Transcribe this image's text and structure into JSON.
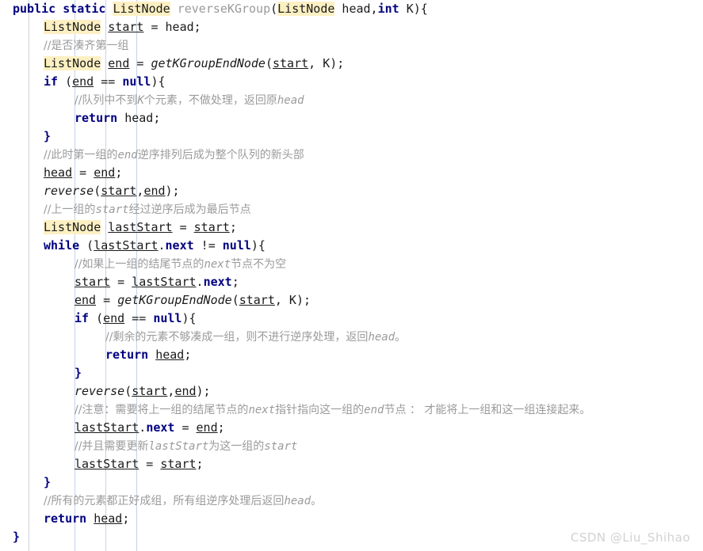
{
  "editor": {
    "language": "java",
    "colors": {
      "keyword": "#000080",
      "highlight_background": "#fcf0c3",
      "comment": "#9b9b9b",
      "method_name": "#9a9a9a",
      "text": "#1a1a1a",
      "indent_guide": "#c3d4e8",
      "background": "#ffffff",
      "watermark": "#d2d2d2"
    },
    "watermark": "CSDN @Liu_Shihao",
    "lines": [
      {
        "indent": 0,
        "tokens": [
          {
            "t": "public",
            "s": "kw"
          },
          {
            "t": " ",
            "s": "plain"
          },
          {
            "t": "static",
            "s": "kw"
          },
          {
            "t": " ",
            "s": "plain"
          },
          {
            "t": "ListNode",
            "s": "type-hl"
          },
          {
            "t": " ",
            "s": "plain"
          },
          {
            "t": "reverseKGroup",
            "s": "mname"
          },
          {
            "t": "(",
            "s": "plain"
          },
          {
            "t": "ListNode",
            "s": "type-hl"
          },
          {
            "t": " head,",
            "s": "plain"
          },
          {
            "t": "int",
            "s": "kw"
          },
          {
            "t": " K){",
            "s": "plain"
          }
        ]
      },
      {
        "indent": 1,
        "tokens": [
          {
            "t": "ListNode",
            "s": "type-hl"
          },
          {
            "t": " ",
            "s": "plain"
          },
          {
            "t": "start",
            "s": "var-u"
          },
          {
            "t": " = head;",
            "s": "plain"
          }
        ]
      },
      {
        "indent": 1,
        "comment": "//是否凑齐第一组"
      },
      {
        "indent": 1,
        "tokens": [
          {
            "t": "ListNode",
            "s": "type-hl"
          },
          {
            "t": " ",
            "s": "plain"
          },
          {
            "t": "end",
            "s": "var-u"
          },
          {
            "t": " = ",
            "s": "plain"
          },
          {
            "t": "getKGroupEndNode",
            "s": "fn-italic"
          },
          {
            "t": "(",
            "s": "plain"
          },
          {
            "t": "start",
            "s": "var-u"
          },
          {
            "t": ", K);",
            "s": "plain"
          }
        ]
      },
      {
        "indent": 1,
        "tokens": [
          {
            "t": "if",
            "s": "kw"
          },
          {
            "t": " (",
            "s": "plain"
          },
          {
            "t": "end",
            "s": "var-u"
          },
          {
            "t": " == ",
            "s": "plain"
          },
          {
            "t": "null",
            "s": "kw"
          },
          {
            "t": "){",
            "s": "plain"
          }
        ]
      },
      {
        "indent": 2,
        "comment": "//队列中不到<i>K</i>个元素，不做处理，返回原<i>head</i>"
      },
      {
        "indent": 2,
        "tokens": [
          {
            "t": "return",
            "s": "kw"
          },
          {
            "t": " head;",
            "s": "plain"
          }
        ]
      },
      {
        "indent": 1,
        "tokens": [
          {
            "t": "}",
            "s": "kw"
          }
        ]
      },
      {
        "indent": 1,
        "comment": "//此时第一组的<i>end</i>逆序排列后成为整个队列的新头部"
      },
      {
        "indent": 1,
        "tokens": [
          {
            "t": "head",
            "s": "var-u"
          },
          {
            "t": " = ",
            "s": "plain"
          },
          {
            "t": "end",
            "s": "var-u"
          },
          {
            "t": ";",
            "s": "plain"
          }
        ]
      },
      {
        "indent": 1,
        "tokens": [
          {
            "t": "reverse",
            "s": "fn-italic"
          },
          {
            "t": "(",
            "s": "plain"
          },
          {
            "t": "start",
            "s": "var-u"
          },
          {
            "t": ",",
            "s": "plain"
          },
          {
            "t": "end",
            "s": "var-u"
          },
          {
            "t": ");",
            "s": "plain"
          }
        ]
      },
      {
        "indent": 1,
        "comment": "//上一组的<i>start</i>经过逆序后成为最后节点"
      },
      {
        "indent": 1,
        "tokens": [
          {
            "t": "ListNode",
            "s": "type-hl"
          },
          {
            "t": " ",
            "s": "plain"
          },
          {
            "t": "lastStart",
            "s": "var-u"
          },
          {
            "t": " = ",
            "s": "plain"
          },
          {
            "t": "start",
            "s": "var-u"
          },
          {
            "t": ";",
            "s": "plain"
          }
        ]
      },
      {
        "indent": 1,
        "tokens": [
          {
            "t": "while",
            "s": "kw"
          },
          {
            "t": " (",
            "s": "plain"
          },
          {
            "t": "lastStart",
            "s": "var-u"
          },
          {
            "t": ".",
            "s": "plain"
          },
          {
            "t": "next",
            "s": "field"
          },
          {
            "t": " != ",
            "s": "plain"
          },
          {
            "t": "null",
            "s": "kw"
          },
          {
            "t": "){",
            "s": "plain"
          }
        ]
      },
      {
        "indent": 2,
        "comment": "//如果上一组的结尾节点的<i>next</i>节点不为空"
      },
      {
        "indent": 2,
        "tokens": [
          {
            "t": "start",
            "s": "var-u"
          },
          {
            "t": " = ",
            "s": "plain"
          },
          {
            "t": "lastStart",
            "s": "var-u"
          },
          {
            "t": ".",
            "s": "plain"
          },
          {
            "t": "next",
            "s": "field"
          },
          {
            "t": ";",
            "s": "plain"
          }
        ]
      },
      {
        "indent": 2,
        "tokens": [
          {
            "t": "end",
            "s": "var-u"
          },
          {
            "t": " = ",
            "s": "plain"
          },
          {
            "t": "getKGroupEndNode",
            "s": "fn-italic"
          },
          {
            "t": "(",
            "s": "plain"
          },
          {
            "t": "start",
            "s": "var-u"
          },
          {
            "t": ", K);",
            "s": "plain"
          }
        ]
      },
      {
        "indent": 2,
        "tokens": [
          {
            "t": "if",
            "s": "kw"
          },
          {
            "t": " (",
            "s": "plain"
          },
          {
            "t": "end",
            "s": "var-u"
          },
          {
            "t": " == ",
            "s": "plain"
          },
          {
            "t": "null",
            "s": "kw"
          },
          {
            "t": "){",
            "s": "plain"
          }
        ]
      },
      {
        "indent": 3,
        "comment": "//剩余的元素不够凑成一组，则不进行逆序处理，返回<i>head</i>。"
      },
      {
        "indent": 3,
        "tokens": [
          {
            "t": "return",
            "s": "kw"
          },
          {
            "t": " ",
            "s": "plain"
          },
          {
            "t": "head",
            "s": "var-u"
          },
          {
            "t": ";",
            "s": "plain"
          }
        ]
      },
      {
        "indent": 2,
        "tokens": [
          {
            "t": "}",
            "s": "kw"
          }
        ]
      },
      {
        "indent": 2,
        "tokens": [
          {
            "t": "reverse",
            "s": "fn-italic"
          },
          {
            "t": "(",
            "s": "plain"
          },
          {
            "t": "start",
            "s": "var-u"
          },
          {
            "t": ",",
            "s": "plain"
          },
          {
            "t": "end",
            "s": "var-u"
          },
          {
            "t": ");",
            "s": "plain"
          }
        ]
      },
      {
        "indent": 2,
        "comment": "//注意：需要将上一组的结尾节点的<i>next</i>指针指向这一组的<i>end</i>节点 ： 才能将上一组和这一组连接起来。"
      },
      {
        "indent": 2,
        "tokens": [
          {
            "t": "lastStart",
            "s": "var-u"
          },
          {
            "t": ".",
            "s": "plain"
          },
          {
            "t": "next",
            "s": "field"
          },
          {
            "t": " = ",
            "s": "plain"
          },
          {
            "t": "end",
            "s": "var-u"
          },
          {
            "t": ";",
            "s": "plain"
          }
        ]
      },
      {
        "indent": 2,
        "comment": "//并且需要更新<i>lastStart</i>为这一组的<i>start</i>"
      },
      {
        "indent": 2,
        "tokens": [
          {
            "t": "lastStart",
            "s": "var-u"
          },
          {
            "t": " = ",
            "s": "plain"
          },
          {
            "t": "start",
            "s": "var-u"
          },
          {
            "t": ";",
            "s": "plain"
          }
        ]
      },
      {
        "indent": 1,
        "tokens": [
          {
            "t": "}",
            "s": "kw"
          }
        ]
      },
      {
        "indent": 1,
        "comment": "//所有的元素都正好成组，所有组逆序处理后返回<i>head</i>。"
      },
      {
        "indent": 1,
        "tokens": [
          {
            "t": "return",
            "s": "kw"
          },
          {
            "t": " ",
            "s": "plain"
          },
          {
            "t": "head",
            "s": "var-u"
          },
          {
            "t": ";",
            "s": "plain"
          }
        ]
      },
      {
        "indent": 0,
        "tokens": [
          {
            "t": "}",
            "s": "kw"
          }
        ]
      }
    ]
  }
}
